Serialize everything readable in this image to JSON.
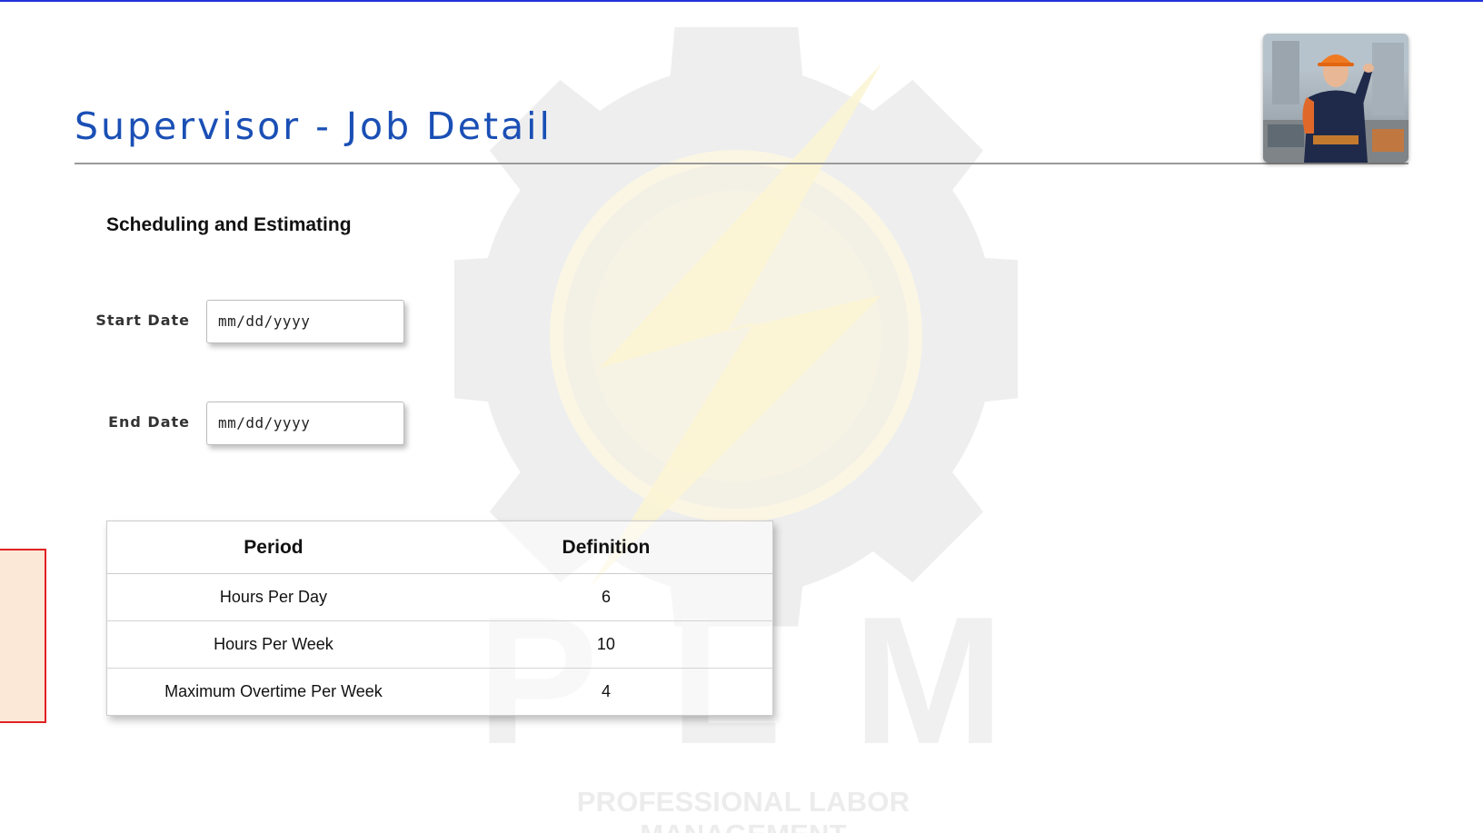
{
  "page": {
    "title": "Supervisor - Job Detail"
  },
  "brand": {
    "letters": [
      "P",
      "L",
      "M"
    ],
    "tagline": "PROFESSIONAL LABOR MANAGEMENT",
    "accent_color": "#1a4fb5",
    "watermark_gear_color": "#eeeeee",
    "watermark_bolt_color": "#fdf7dc"
  },
  "avatar": {
    "icon": "worker-photo"
  },
  "section": {
    "title": "Scheduling and Estimating"
  },
  "fields": {
    "start_date": {
      "label": "Start Date",
      "placeholder": "mm/dd/yyyy"
    },
    "end_date": {
      "label": "End Date",
      "placeholder": "mm/dd/yyyy"
    }
  },
  "table": {
    "headers": [
      "Period",
      "Definition"
    ],
    "rows": [
      {
        "period": "Hours Per Day",
        "definition": "6"
      },
      {
        "period": "Hours Per Week",
        "definition": "10"
      },
      {
        "period": "Maximum Overtime Per Week",
        "definition": "4"
      }
    ]
  },
  "side_box": {
    "fill_color": "#fbe8d7",
    "border_color": "#e02222"
  }
}
